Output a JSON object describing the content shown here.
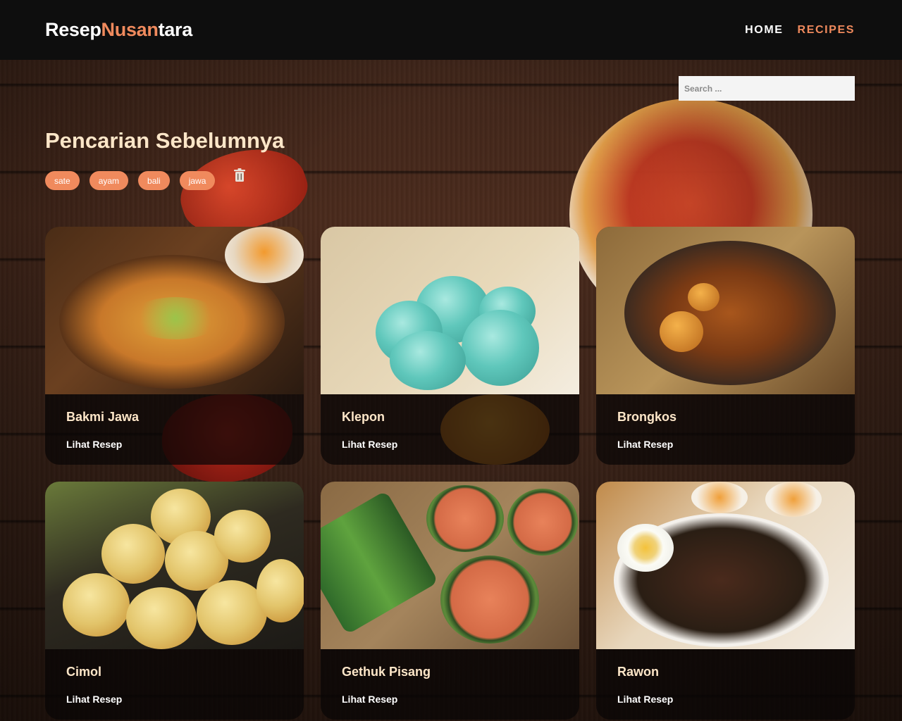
{
  "brand": {
    "part1": "Resep",
    "part2": "Nusan",
    "part3": "tara"
  },
  "nav": [
    {
      "label": "HOME",
      "active": false
    },
    {
      "label": "RECIPES",
      "active": true
    }
  ],
  "search": {
    "placeholder": "Search ...",
    "value": ""
  },
  "previous_searches": {
    "title": "Pencarian Sebelumnya",
    "tags": [
      "sate",
      "ayam",
      "bali",
      "jawa"
    ],
    "clear_icon": "trash-icon"
  },
  "recipes": [
    {
      "title": "Bakmi Jawa",
      "link": "Lihat Resep"
    },
    {
      "title": "Klepon",
      "link": "Lihat Resep"
    },
    {
      "title": "Brongkos",
      "link": "Lihat Resep"
    },
    {
      "title": "Cimol",
      "link": "Lihat Resep"
    },
    {
      "title": "Gethuk Pisang",
      "link": "Lihat Resep"
    },
    {
      "title": "Rawon",
      "link": "Lihat Resep"
    }
  ],
  "colors": {
    "accent": "#f08a5d",
    "header_bg": "#0e0e0e",
    "heading_text": "#fde6c8"
  }
}
